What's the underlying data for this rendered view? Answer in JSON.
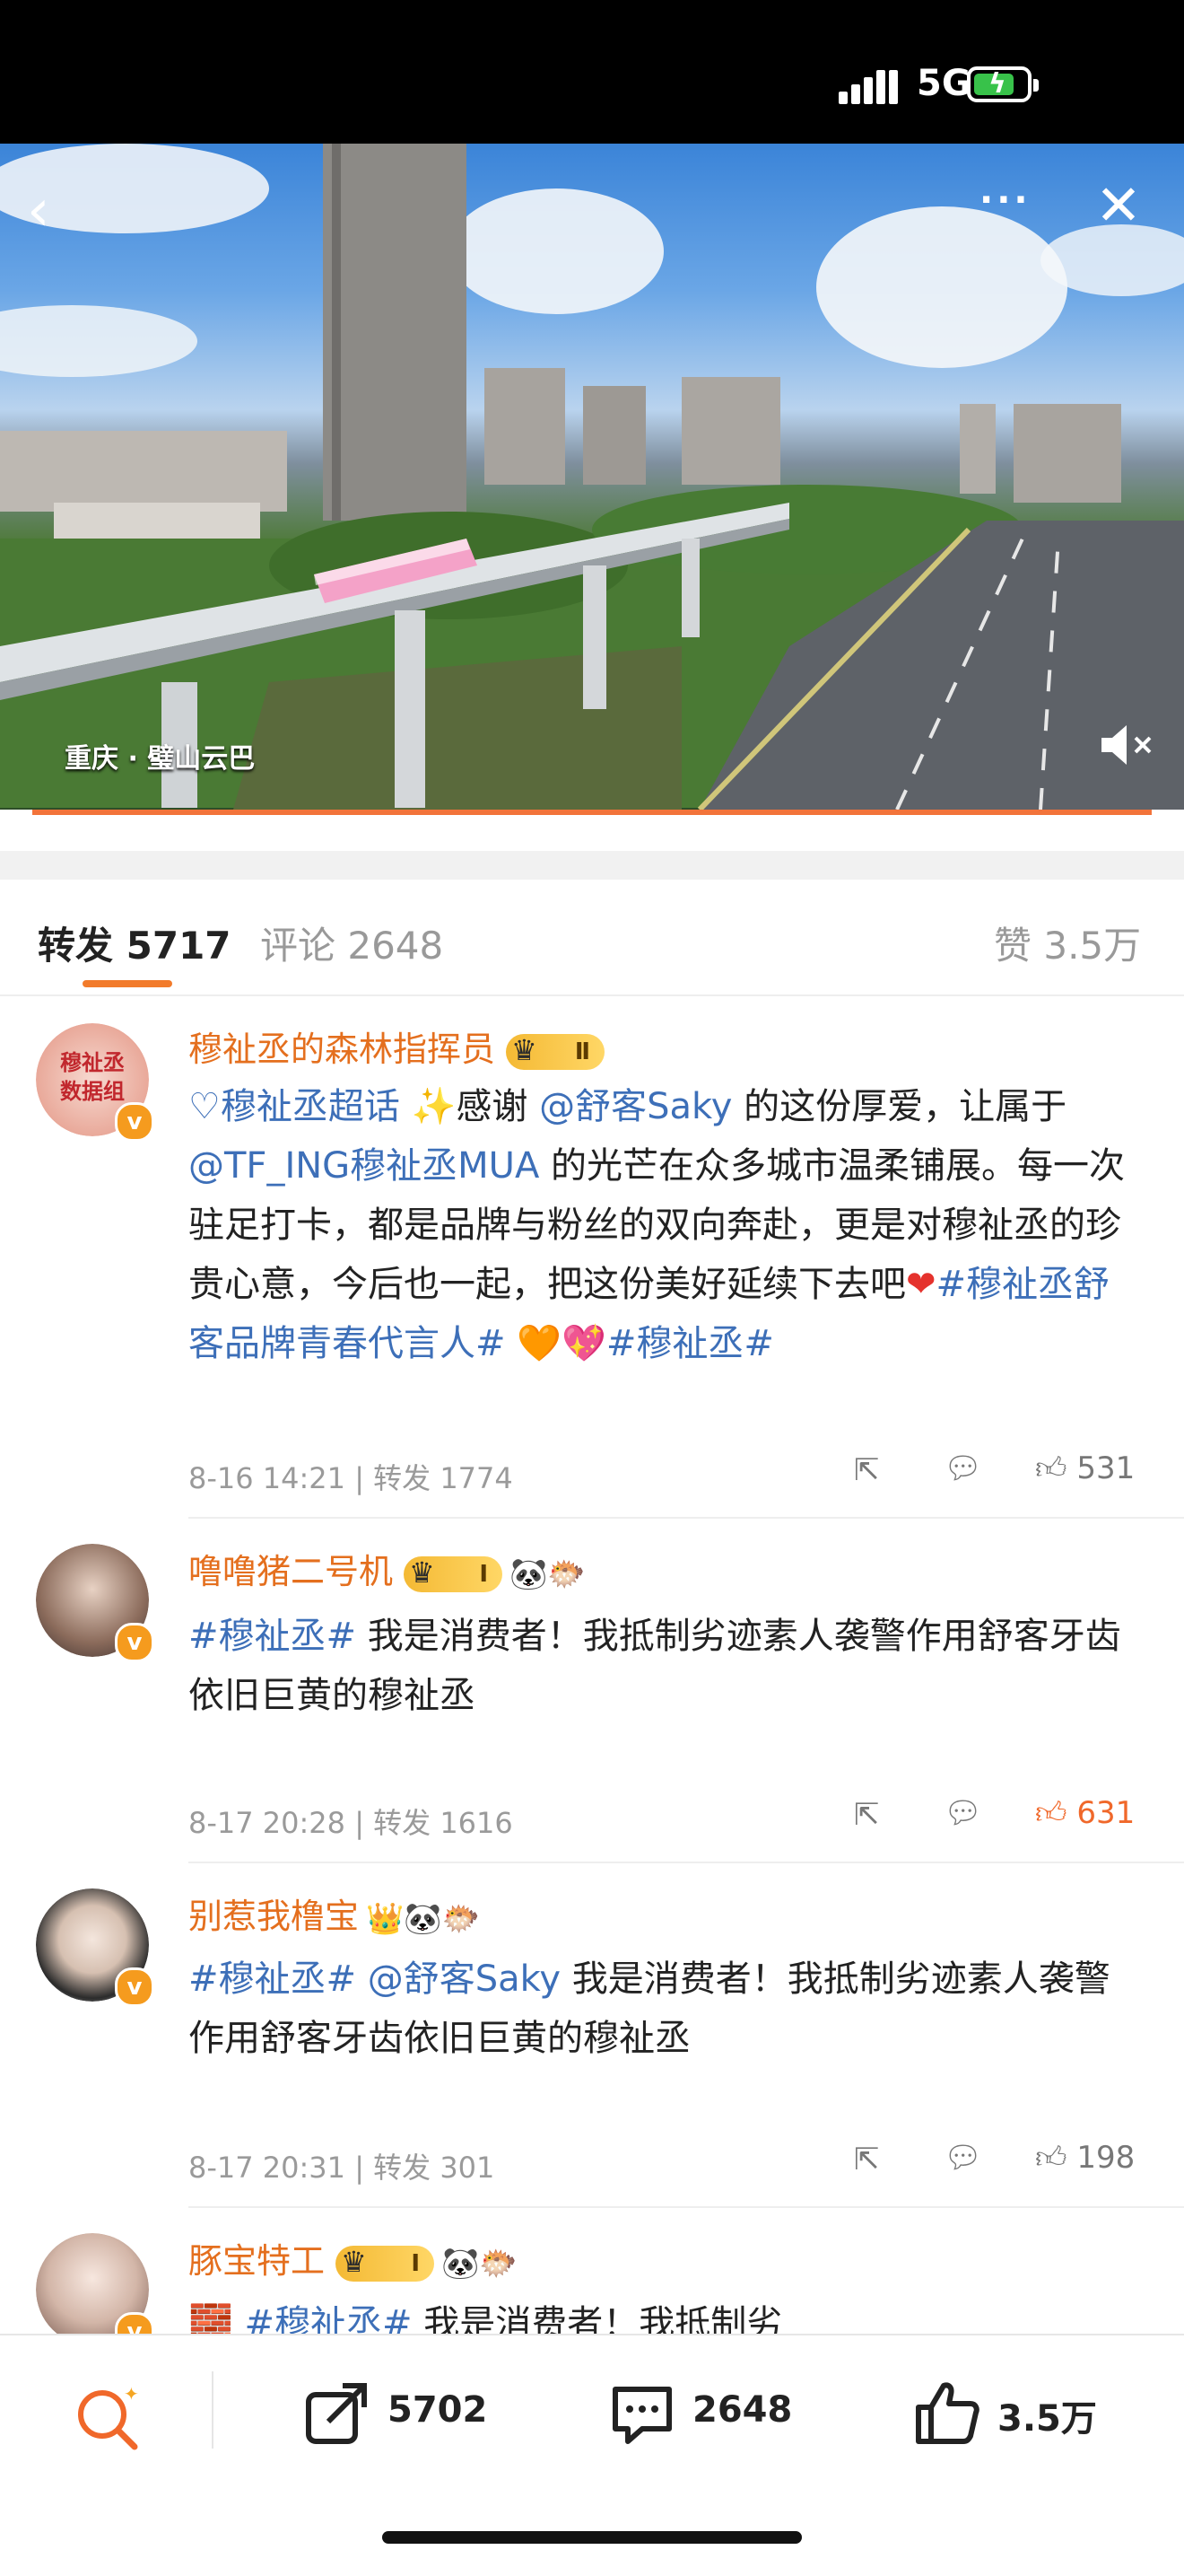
{
  "status_bar": {
    "network": "5G",
    "battery_icon": "battery-charging-icon"
  },
  "hero": {
    "caption": "重庆 · 璧山云巴",
    "more_label": "···",
    "progress": 1.0,
    "icons": [
      "back-arrow-icon",
      "more-icon",
      "close-icon",
      "mute-icon"
    ]
  },
  "tabs": {
    "repost_label": "转发",
    "repost_count": "5717",
    "comment_label": "评论 2648",
    "like_label": "赞 3.5万"
  },
  "comments": [
    {
      "name": "穆祉丞的森林指挥员",
      "level": "Ⅱ",
      "avatar_text": "穆祉丞\n数据组",
      "segments": [
        {
          "t": "♡穆祉丞超话",
          "c": "tag"
        },
        {
          "t": " ✨感谢 ",
          "c": ""
        },
        {
          "t": "@舒客Saky",
          "c": "mention"
        },
        {
          "t": " 的这份厚爱，让属于 ",
          "c": ""
        },
        {
          "t": "@TF_ING穆祉丞MUA",
          "c": "mention"
        },
        {
          "t": " 的光芒在众多城市温柔铺展。每一次驻足打卡，都是品牌与粉丝的双向奔赴，更是对穆祉丞的珍贵心意，今后也一起，把这份美好延续下去吧",
          "c": ""
        },
        {
          "t": "❤",
          "c": "heart"
        },
        {
          "t": "#穆祉丞舒客品牌青春代言人#",
          "c": "tag"
        },
        {
          "t": " 🧡💖",
          "c": ""
        },
        {
          "t": "#穆祉丞#",
          "c": "tag"
        }
      ],
      "time": "8-16 14:21",
      "repost": "转发 1774",
      "likes": "531",
      "liked": false
    },
    {
      "name": "噜噜猪二号机",
      "level": "Ⅰ",
      "emojis": "🐼🐡",
      "segments": [
        {
          "t": "#穆祉丞#",
          "c": "tag"
        },
        {
          "t": " 我是消费者！我抵制劣迹素人袭警作用舒客牙齿依旧巨黄的穆祉丞",
          "c": ""
        }
      ],
      "time": "8-17 20:28",
      "repost": "转发 1616",
      "likes": "631",
      "liked": true
    },
    {
      "name": "别惹我橹宝",
      "emojis": "👑🐼🐡",
      "segments": [
        {
          "t": "#穆祉丞#",
          "c": "tag"
        },
        {
          "t": " ",
          "c": ""
        },
        {
          "t": "@舒客Saky",
          "c": "mention"
        },
        {
          "t": " 我是消费者！我抵制劣迹素人袭警作用舒客牙齿依旧巨黄的穆祉丞",
          "c": ""
        }
      ],
      "time": "8-17 20:31",
      "repost": "转发 301",
      "likes": "198",
      "liked": false
    },
    {
      "name": "豚宝特工",
      "level": "Ⅰ",
      "emojis": "🐼🐡",
      "segments": [
        {
          "t": "🧱 ",
          "c": ""
        },
        {
          "t": "#穆祉丞#",
          "c": "tag"
        },
        {
          "t": " 我是消费者！我抵制劣",
          "c": ""
        }
      ]
    }
  ],
  "bottom_bar": {
    "repost_count": "5702",
    "comment_count": "2648",
    "like_count": "3.5万"
  },
  "colors": {
    "accent": "#f27b2b",
    "link": "#3d6fb8",
    "name": "#e46f1e"
  }
}
